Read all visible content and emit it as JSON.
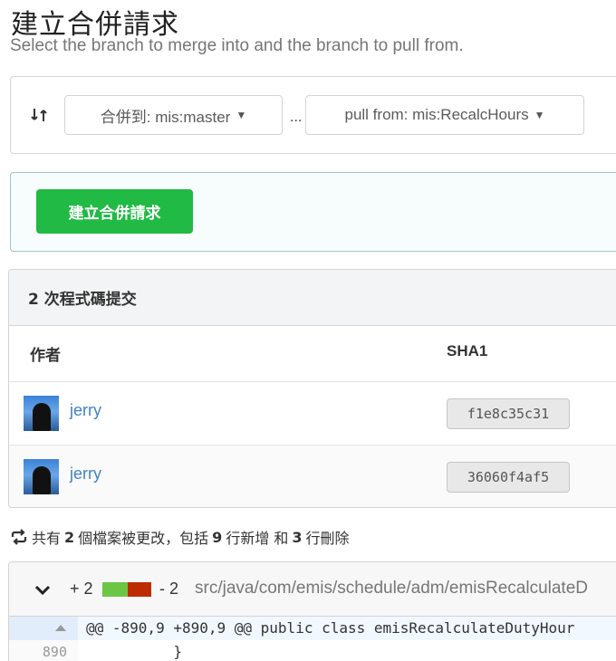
{
  "page": {
    "title": "建立合併請求",
    "subtitle": "Select the branch to merge into and the branch to pull from."
  },
  "branches": {
    "base_label": "合併到: mis:master",
    "separator": "...",
    "head_label": "pull from: mis:RecalcHours"
  },
  "actions": {
    "create_button": "建立合併請求"
  },
  "commits": {
    "header": "2 次程式碼提交",
    "columns": {
      "author": "作者",
      "sha": "SHA1"
    },
    "rows": [
      {
        "author": "jerry",
        "sha": "f1e8c35c31"
      },
      {
        "author": "jerry",
        "sha": "36060f4af5"
      }
    ]
  },
  "summary": {
    "prefix": "共有",
    "files": "2",
    "files_text": "個檔案被更改，包括",
    "additions": "9",
    "additions_text": "行新增 和",
    "deletions": "3",
    "deletions_text": "行刪除"
  },
  "diff": {
    "additions_label": "+ 2",
    "deletions_label": "- 2",
    "file_path": "src/java/com/emis/schedule/adm/emisRecalculateD",
    "hunk_header": "@@ -890,9 +890,9 @@ public class emisRecalculateDutyHour",
    "lines": [
      {
        "number": "890",
        "code": "          }"
      }
    ]
  },
  "colors": {
    "primary_green": "#21ba45",
    "link_blue": "#4183c4",
    "diff_add": "#6cc644",
    "diff_del": "#bd2c00"
  },
  "icons": {
    "merge": "git-compare-icon",
    "caret": "caret-down-icon",
    "repeat": "repeat-icon",
    "chevron": "chevron-down-icon",
    "expand": "expand-up-icon"
  }
}
